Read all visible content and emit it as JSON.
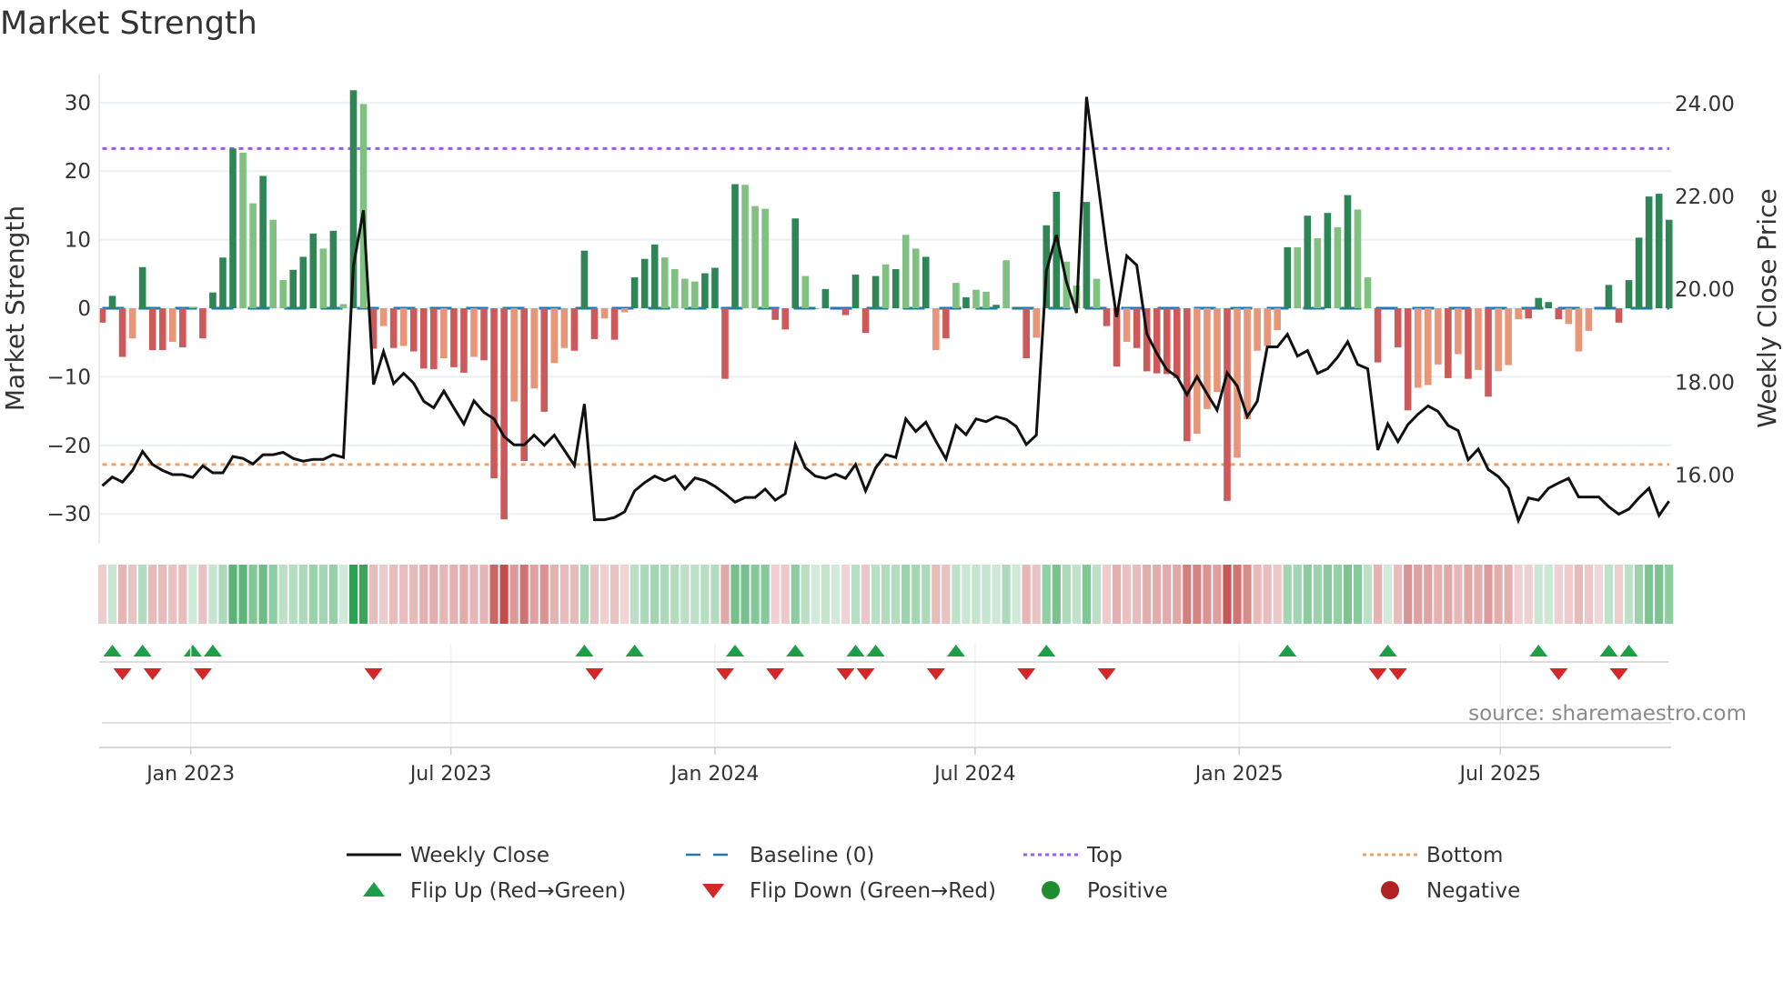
{
  "chart_data": {
    "type": "bar+line",
    "title": "Market Strength",
    "ylabel": "Market Strength",
    "ylabel_right": "Weekly Close Price",
    "ylim": [
      -35,
      35
    ],
    "ylim_right": [
      14.53,
      25.38
    ],
    "yticks": [
      30,
      20,
      10,
      0,
      -10,
      -20,
      -30
    ],
    "yticks_labels": [
      "30",
      "20",
      "10",
      "0",
      "−10",
      "−20",
      "−30"
    ],
    "yticks_right": [
      24,
      22,
      20,
      18,
      16
    ],
    "yticks_right_labels": [
      "24.00",
      "22.00",
      "20.00",
      "18.00",
      "16.00"
    ],
    "x_unit": "week index",
    "xticks": [
      {
        "label": "Jan 2023",
        "week": 8.8
      },
      {
        "label": "Jul 2023",
        "week": 34.7
      },
      {
        "label": "Jan 2024",
        "week": 61.0
      },
      {
        "label": "Jul 2024",
        "week": 86.9
      },
      {
        "label": "Jan 2025",
        "week": 113.2
      },
      {
        "label": "Jul 2025",
        "week": 139.2
      }
    ],
    "top_level": 23.3,
    "bottom_level": -22.8,
    "baseline": 0,
    "strength": [
      -2.1,
      1.8,
      -7.1,
      -4.4,
      6.0,
      -6.1,
      -6.1,
      -4.9,
      -5.7,
      0.2,
      -4.4,
      2.3,
      7.4,
      23.3,
      22.7,
      15.3,
      19.3,
      12.9,
      4.1,
      5.6,
      7.5,
      10.9,
      8.7,
      11.3,
      0.6,
      31.8,
      29.8,
      -5.9,
      -2.6,
      -5.8,
      -5.5,
      -6.3,
      -8.8,
      -8.9,
      -7.3,
      -8.6,
      -9.4,
      -7.1,
      -7.6,
      -24.8,
      -30.8,
      -13.6,
      -22.3,
      -11.7,
      -15.1,
      -8.0,
      -5.8,
      -6.2,
      8.4,
      -4.5,
      -1.5,
      -4.6,
      -0.6,
      4.5,
      7.2,
      9.3,
      7.4,
      5.7,
      4.3,
      3.9,
      5.1,
      5.9,
      -10.3,
      18.1,
      18.0,
      14.9,
      14.5,
      -1.7,
      -3.1,
      13.1,
      4.7,
      0,
      2.8,
      0,
      -1.0,
      4.9,
      -3.6,
      4.7,
      6.4,
      5.7,
      10.7,
      8.7,
      7.5,
      -6.1,
      -4.4,
      3.7,
      1.6,
      2.7,
      2.4,
      0.5,
      7.0,
      0.2,
      -7.3,
      -4.3,
      12.1,
      17.0,
      6.8,
      3.3,
      15.5,
      4.3,
      -2.6,
      -8.5,
      -4.9,
      -5.8,
      -9.2,
      -9.5,
      -9.6,
      -10.2,
      -19.4,
      -18.3,
      -14.7,
      -12.2,
      -28.1,
      -21.8,
      -16.2,
      -6.2,
      -5.5,
      -3.2,
      8.9,
      8.9,
      13.5,
      10.2,
      13.9,
      11.8,
      16.5,
      14.4,
      4.5,
      -7.9,
      0,
      -5.7,
      -14.9,
      -11.6,
      -11.2,
      -8.2,
      -10.2,
      -6.7,
      -10.3,
      -9.0,
      -12.9,
      -9.2,
      -8.3,
      -1.6,
      -1.5,
      1.5,
      0.9,
      -1.6,
      -2.3,
      -6.3,
      -3.3,
      -0.1,
      3.4,
      -2.1,
      4.1,
      10.3,
      16.3,
      16.7,
      12.9
    ],
    "strength_shade": "DDDLDDDLDLDDDDLLDLLDDDLDLDLDLDLDDDLDDLDDDLDLDLLDDDLDLDDDLLLLDDDDLLLDDDLDDDDDDDLDLLDLDLDLLDLDDLDDLLDLDDLDDDDDDLLLDLLLLLDLDLDLDLLDDDDLLLDLDLDLLLDDDDLLLDDDDDDDDL",
    "weekly_close": [
      15.77,
      15.96,
      15.85,
      16.1,
      16.51,
      16.23,
      16.1,
      16.01,
      16.01,
      15.95,
      16.2,
      16.05,
      16.05,
      16.4,
      16.36,
      16.24,
      16.44,
      16.44,
      16.49,
      16.36,
      16.3,
      16.34,
      16.34,
      16.44,
      16.38,
      20.51,
      21.7,
      17.95,
      18.66,
      17.97,
      18.19,
      17.98,
      17.59,
      17.45,
      17.81,
      17.45,
      17.1,
      17.6,
      17.35,
      17.21,
      16.83,
      16.65,
      16.65,
      16.86,
      16.64,
      16.86,
      16.54,
      16.21,
      17.53,
      15.04,
      15.04,
      15.09,
      15.21,
      15.66,
      15.84,
      15.98,
      15.88,
      15.98,
      15.7,
      15.94,
      15.88,
      15.76,
      15.6,
      15.42,
      15.52,
      15.52,
      15.7,
      15.46,
      15.6,
      16.66,
      16.16,
      15.98,
      15.93,
      16.02,
      15.93,
      16.23,
      15.66,
      16.16,
      16.44,
      16.38,
      17.21,
      16.94,
      17.14,
      16.73,
      16.35,
      17.07,
      16.87,
      17.21,
      17.15,
      17.26,
      17.2,
      17.05,
      16.66,
      16.86,
      20.4,
      21.17,
      20.16,
      19.49,
      24.14,
      22.5,
      20.86,
      19.4,
      20.72,
      20.52,
      19.04,
      18.62,
      18.27,
      18.12,
      17.73,
      18.12,
      17.75,
      17.4,
      18.2,
      17.92,
      17.26,
      17.59,
      18.76,
      18.76,
      19.03,
      18.56,
      18.68,
      18.19,
      18.29,
      18.54,
      18.87,
      18.38,
      18.29,
      16.54,
      17.1,
      16.72,
      17.09,
      17.31,
      17.49,
      17.37,
      17.07,
      16.96,
      16.33,
      16.56,
      16.12,
      15.97,
      15.72,
      15.02,
      15.51,
      15.46,
      15.72,
      15.83,
      15.93,
      15.53,
      15.53,
      15.53,
      15.32,
      15.16,
      15.27,
      15.51,
      15.72,
      15.13,
      15.44
    ],
    "flip_up_weeks": [
      1,
      4,
      9,
      11,
      48,
      53,
      63,
      69,
      75,
      77,
      85,
      94,
      118,
      128,
      143,
      150,
      152
    ],
    "flip_down_weeks": [
      2,
      5,
      10,
      27,
      49,
      62,
      67,
      74,
      76,
      83,
      92,
      100,
      127,
      129,
      145,
      151
    ],
    "legend": [
      {
        "label": "Weekly Close",
        "kind": "line"
      },
      {
        "label": "Baseline (0)",
        "kind": "dash"
      },
      {
        "label": "Top",
        "kind": "dot-purple"
      },
      {
        "label": "Bottom",
        "kind": "dot-orange"
      },
      {
        "label": "Flip Up (Red→Green)",
        "kind": "tri-up"
      },
      {
        "label": "Flip Down (Green→Red)",
        "kind": "tri-down"
      },
      {
        "label": "Positive",
        "kind": "dot-green"
      },
      {
        "label": "Negative",
        "kind": "dot-red"
      }
    ],
    "legend_placement": "bottom",
    "source": "source: sharemaestro.com",
    "colors": {
      "pos_dark": "#2e8656",
      "pos_light": "#80c080",
      "neg_dark": "#cd5a5a",
      "neg_light": "#e8967a",
      "line": "#111111",
      "baseline": "#1f77b4",
      "top": "#9b5de0",
      "bottom": "#f0a060",
      "flip_up": "#1f9e48",
      "flip_down": "#d62728",
      "positive": "#1f8c2e",
      "negative": "#b22222"
    }
  }
}
